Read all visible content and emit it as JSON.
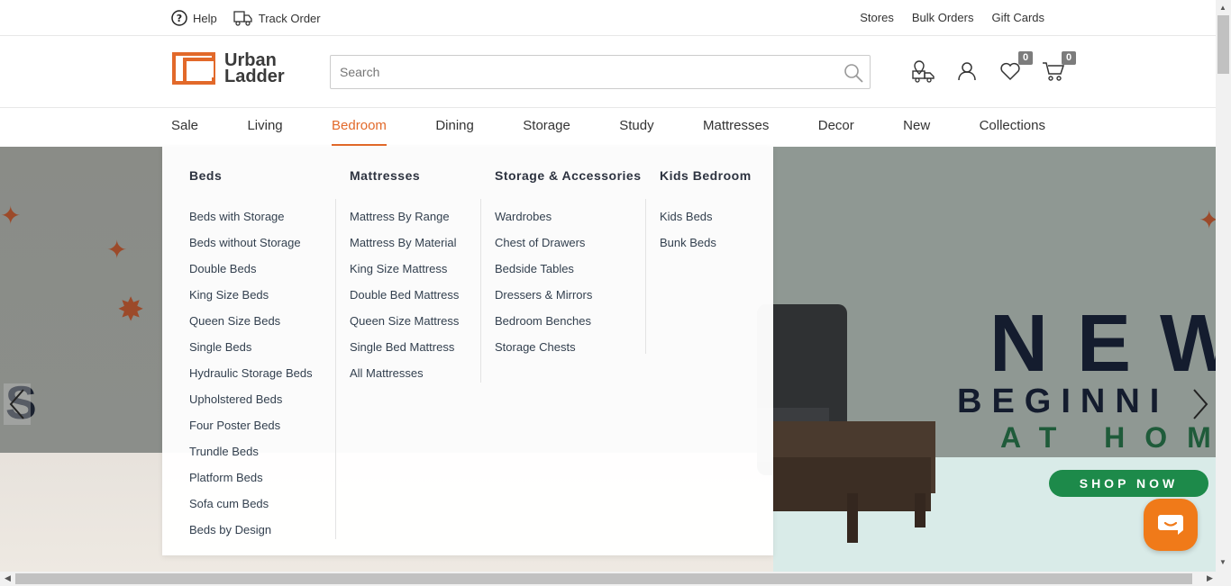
{
  "topbar": {
    "help": "Help",
    "track_order": "Track Order",
    "stores": "Stores",
    "bulk_orders": "Bulk Orders",
    "gift_cards": "Gift Cards"
  },
  "logo": {
    "line1": "Urban",
    "line2": "Ladder"
  },
  "search": {
    "placeholder": "Search",
    "value": ""
  },
  "header_icons": {
    "wishlist_count": "0",
    "cart_count": "0"
  },
  "nav": [
    "Sale",
    "Living",
    "Bedroom",
    "Dining",
    "Storage",
    "Study",
    "Mattresses",
    "Decor",
    "New",
    "Collections"
  ],
  "active_nav": "Bedroom",
  "mega_menu": {
    "beds": {
      "title": "Beds",
      "items": [
        "Beds with Storage",
        "Beds without Storage",
        "Double Beds",
        "King Size Beds",
        "Queen Size Beds",
        "Single Beds",
        "Hydraulic Storage Beds",
        "Upholstered Beds",
        "Four Poster Beds",
        "Trundle Beds",
        "Platform Beds",
        "Sofa cum Beds",
        "Beds by Design"
      ]
    },
    "mattresses": {
      "title": "Mattresses",
      "items": [
        "Mattress By Range",
        "Mattress By Material",
        "King Size Mattress",
        "Double Bed Mattress",
        "Queen Size Mattress",
        "Single Bed Mattress",
        "All Mattresses"
      ]
    },
    "storage": {
      "title": "Storage & Accessories",
      "items": [
        "Wardrobes",
        "Chest of Drawers",
        "Bedside Tables",
        "Dressers & Mirrors",
        "Bedroom Benches",
        "Storage Chests"
      ]
    },
    "kids": {
      "title": "Kids Bedroom",
      "items": [
        "Kids Beds",
        "Bunk Beds"
      ]
    }
  },
  "hero": {
    "left_text": "S",
    "headline": "NEW",
    "subline": "BEGINNI",
    "tagline": "AT HOM",
    "cta": "SHOP NOW"
  },
  "colors": {
    "accent": "#e2692a",
    "cta": "#1d8a4a",
    "chat": "#f07a19"
  }
}
